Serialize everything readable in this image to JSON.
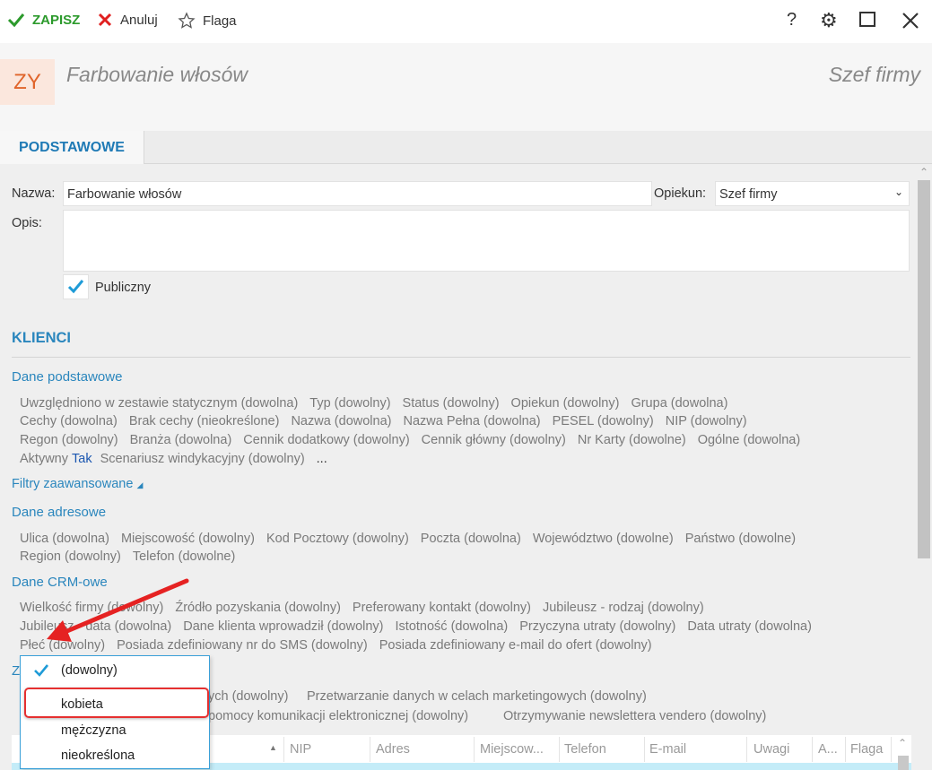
{
  "toolbar": {
    "save": "ZAPISZ",
    "cancel": "Anuluj",
    "flag": "Flaga",
    "help": "?"
  },
  "header": {
    "avatar": "ZY",
    "title": "Farbowanie włosów",
    "owner": "Szef firmy"
  },
  "tabs": [
    {
      "label": "PODSTAWOWE"
    }
  ],
  "form": {
    "name_label": "Nazwa:",
    "name_value": "Farbowanie włosów",
    "guardian_label": "Opiekun:",
    "guardian_value": "Szef firmy",
    "desc_label": "Opis:",
    "public_label": "Publiczny"
  },
  "clients": {
    "title": "KLIENCI",
    "basic": {
      "title": "Dane podstawowe",
      "rows": [
        [
          "Uwzględniono w zestawie statycznym (dowolna)",
          "Typ (dowolny)",
          "Status (dowolny)",
          "Opiekun (dowolny)",
          "Grupa (dowolna)"
        ],
        [
          "Cechy (dowolna)",
          "Brak cechy (nieokreślone)",
          "Nazwa (dowolna)",
          "Nazwa Pełna (dowolna)",
          "PESEL (dowolny)",
          "NIP (dowolny)"
        ],
        [
          "Regon (dowolny)",
          "Branża (dowolna)",
          "Cennik dodatkowy (dowolny)",
          "Cennik główny (dowolny)",
          "Nr Karty (dowolne)",
          "Ogólne (dowolna)"
        ]
      ],
      "active_label": "Aktywny",
      "active_value": "Tak",
      "last": "Scenariusz windykacyjny (dowolny)",
      "more": "..."
    },
    "advanced": "Filtry zaawansowane",
    "address": {
      "title": "Dane adresowe",
      "rows": [
        [
          "Ulica (dowolna)",
          "Miejscowość (dowolny)",
          "Kod Pocztowy (dowolny)",
          "Poczta (dowolna)",
          "Województwo (dowolne)",
          "Państwo (dowolne)"
        ],
        [
          "Region (dowolny)",
          "Telefon (dowolne)"
        ]
      ]
    },
    "crm": {
      "title": "Dane CRM-owe",
      "rows": [
        [
          "Wielkość firmy (dowolny)",
          "Źródło pozyskania (dowolny)",
          "Preferowany kontakt (dowolny)",
          "Jubileusz - rodzaj (dowolny)"
        ],
        [
          "Jubileusz - data (dowolna)",
          "Dane klienta wprowadził (dowolny)",
          "Istotność (dowolna)",
          "Przyczyna utraty (dowolny)",
          "Data utraty (dowolna)"
        ],
        [
          "Płeć (dowolny)",
          "Posiada zdefiniowany nr do SMS (dowolny)",
          "Posiada zdefiniowany e-mail do ofert (dowolny)"
        ]
      ]
    },
    "consents": {
      "title": "Z",
      "row1a": "ych (dowolny)",
      "row1b": "Przetwarzanie danych w celach marketingowych (dowolny)",
      "row2a": "pomocy komunikacji elektronicznej (dowolny)",
      "row2b": "Otrzymywanie newslettera vendero (dowolny)"
    }
  },
  "dropdown": {
    "options": [
      "(dowolny)",
      "kobieta",
      "mężczyzna",
      "nieokreślona"
    ],
    "selected": "(dowolny)",
    "highlighted": "kobieta"
  },
  "table": {
    "columns": [
      "NIP",
      "Adres",
      "Miejscow...",
      "Telefon",
      "E-mail",
      "Uwagi",
      "A...",
      "Flaga"
    ]
  }
}
